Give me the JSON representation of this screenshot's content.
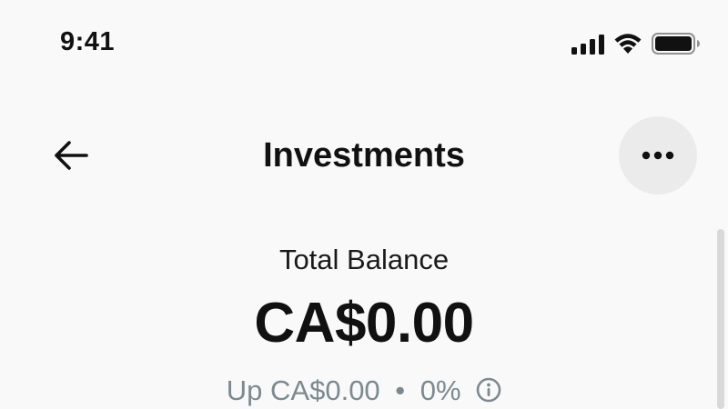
{
  "status_bar": {
    "time": "9:41",
    "icons": [
      "cellular-signal-icon",
      "wifi-icon",
      "battery-icon"
    ]
  },
  "header": {
    "back_icon": "arrow-left-icon",
    "title": "Investments",
    "more_icon": "ellipsis-icon"
  },
  "balance": {
    "label": "Total Balance",
    "value": "CA$0.00",
    "change_prefix": "Up",
    "change_amount": "CA$0.00",
    "separator": "•",
    "change_percent": "0%",
    "info_icon": "info-circle-icon"
  },
  "colors": {
    "background": "#f9f9f9",
    "text_primary": "#111111",
    "text_muted": "#7c8a90",
    "button_bg": "#ebebeb"
  }
}
